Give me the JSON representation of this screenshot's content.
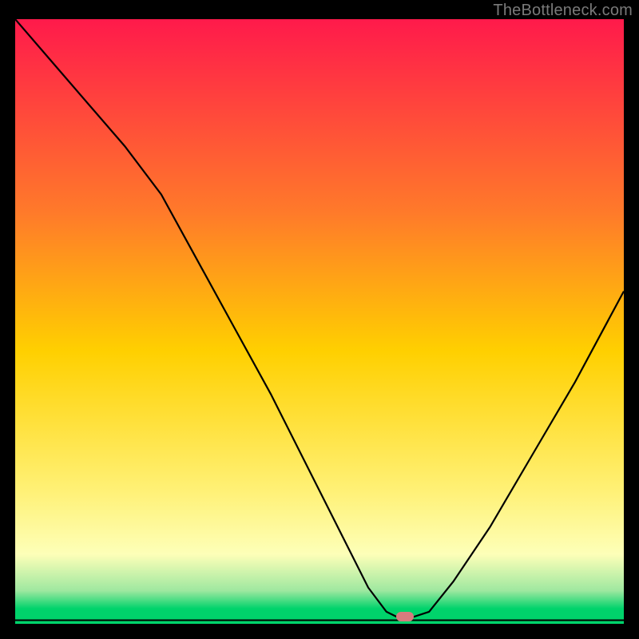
{
  "watermark": "TheBottleneck.com",
  "colors": {
    "top": "#ff1a4b",
    "mid_upper": "#ff7a2a",
    "mid": "#ffd000",
    "mid_lower": "#fff176",
    "pale": "#fdffb8",
    "green_light": "#9fe8a0",
    "green": "#00d36b",
    "marker": "#d87b7e",
    "curve": "#000000"
  },
  "chart_data": {
    "type": "line",
    "title": "",
    "xlabel": "",
    "ylabel": "",
    "xlim": [
      0,
      100
    ],
    "ylim": [
      0,
      100
    ],
    "gradient_stops": [
      {
        "offset": 0.0,
        "color_key": "top"
      },
      {
        "offset": 0.32,
        "color_key": "mid_upper"
      },
      {
        "offset": 0.55,
        "color_key": "mid"
      },
      {
        "offset": 0.78,
        "color_key": "mid_lower"
      },
      {
        "offset": 0.885,
        "color_key": "pale"
      },
      {
        "offset": 0.945,
        "color_key": "green_light"
      },
      {
        "offset": 0.975,
        "color_key": "green"
      },
      {
        "offset": 1.0,
        "color_key": "green"
      }
    ],
    "series": [
      {
        "name": "bottleneck-curve",
        "x": [
          0,
          6,
          12,
          18,
          24,
          30,
          36,
          42,
          48,
          54,
          58,
          61,
          63,
          65,
          68,
          72,
          78,
          85,
          92,
          100
        ],
        "y": [
          100,
          93,
          86,
          79,
          71,
          60,
          49,
          38,
          26,
          14,
          6,
          2,
          1,
          1,
          2,
          7,
          16,
          28,
          40,
          55
        ]
      }
    ],
    "marker": {
      "x": 64,
      "y": 1.2
    },
    "baseline_y": 0.6
  }
}
